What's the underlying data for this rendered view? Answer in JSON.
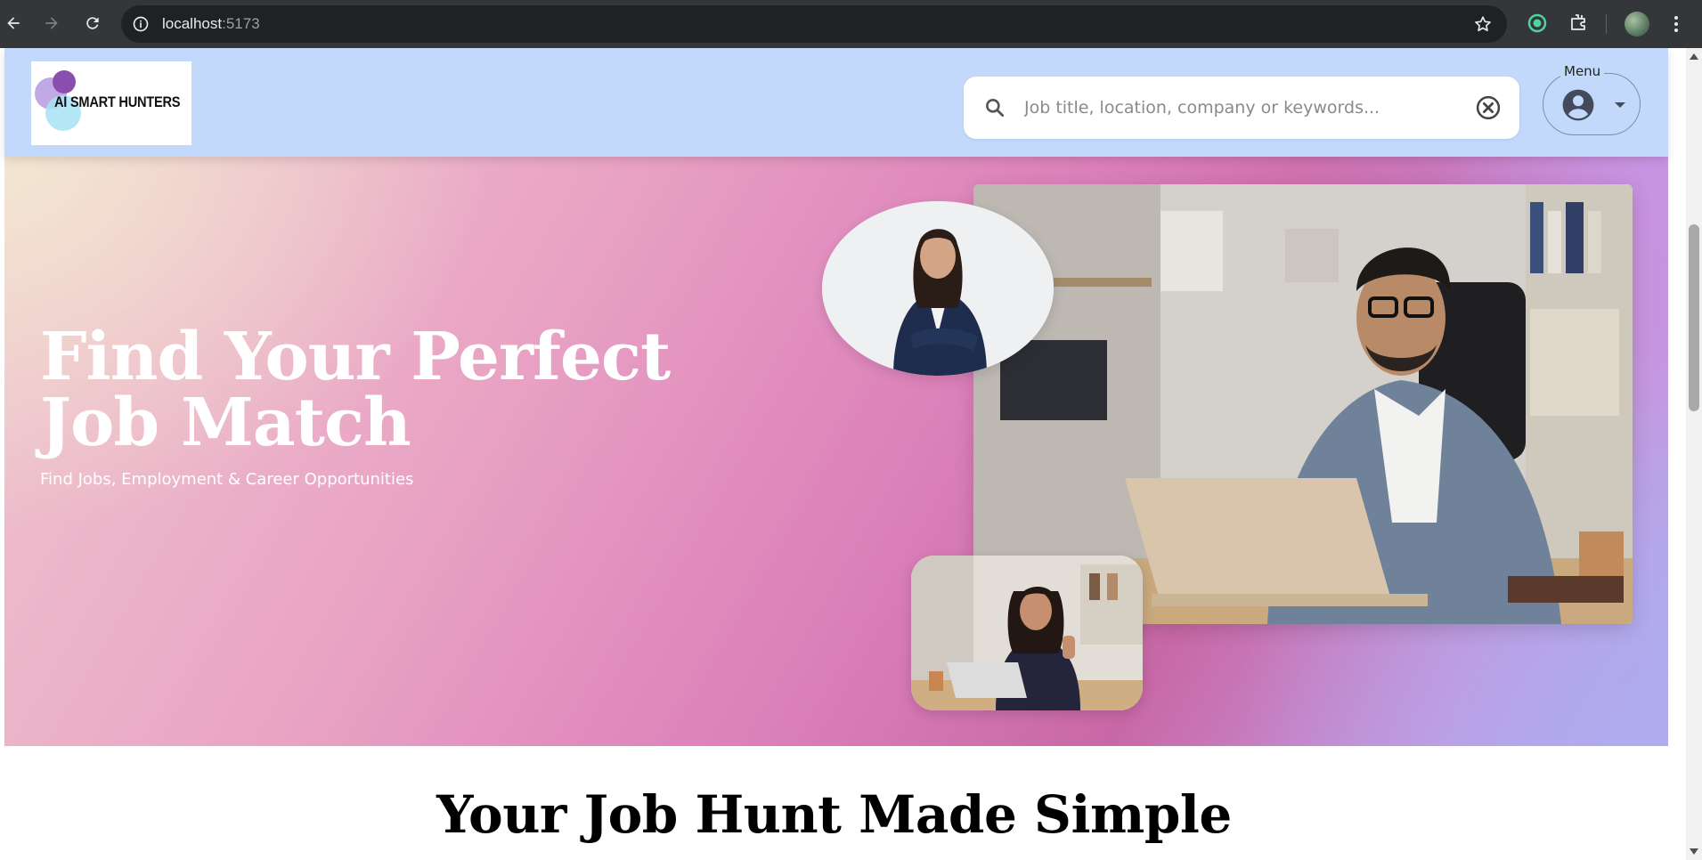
{
  "browser": {
    "url_host": "localhost",
    "url_port": ":5173",
    "icons": [
      "back-icon",
      "forward-icon",
      "reload-icon",
      "site-info-icon",
      "bookmark-star-icon",
      "extension-icon",
      "puzzle-icon",
      "profile-avatar",
      "kebab-menu-icon"
    ]
  },
  "header": {
    "logo_text": "AI SMART HUNTERS",
    "search_placeholder": "Job title, location, company or keywords...",
    "menu_label": "Menu",
    "colors": {
      "header_bg": "#c2d9fb",
      "search_bg": "#ffffff"
    }
  },
  "hero": {
    "title_line1": "Find Your Perfect",
    "title_line2": "Job Match",
    "subtitle": "Find Jobs, Employment & Career Opportunities",
    "images": [
      "professional-woman-arms-crossed-photo",
      "man-working-on-laptop-photo",
      "woman-thumbs-up-at-desk-photo"
    ]
  },
  "section": {
    "title": "Your Job Hunt Made Simple"
  }
}
